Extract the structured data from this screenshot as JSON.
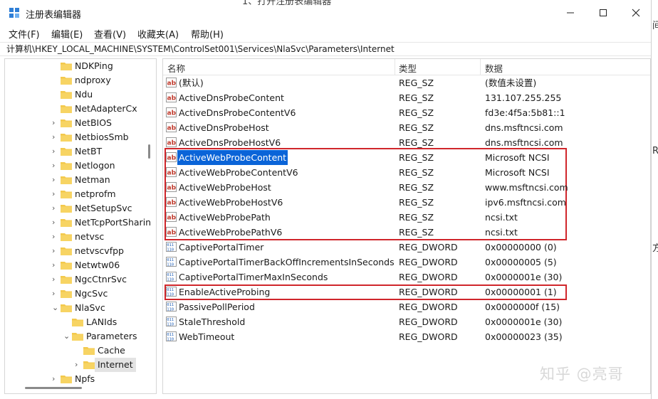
{
  "window": {
    "title": "注册表编辑器",
    "minimize": "—",
    "maximize": "☐",
    "close": "✕"
  },
  "background_header": "1、打开注册表编辑器",
  "menu": [
    "文件(F)",
    "编辑(E)",
    "查看(V)",
    "收藏夹(A)",
    "帮助(H)"
  ],
  "address": "计算机\\HKEY_LOCAL_MACHINE\\SYSTEM\\ControlSet001\\Services\\NlaSvc\\Parameters\\Internet",
  "tree": [
    {
      "label": "NDKPing",
      "level": 0,
      "chevron": ""
    },
    {
      "label": "ndproxy",
      "level": 0,
      "chevron": ""
    },
    {
      "label": "Ndu",
      "level": 0,
      "chevron": ""
    },
    {
      "label": "NetAdapterCx",
      "level": 0,
      "chevron": ""
    },
    {
      "label": "NetBIOS",
      "level": 0,
      "chevron": "›"
    },
    {
      "label": "NetbiosSmb",
      "level": 0,
      "chevron": "›"
    },
    {
      "label": "NetBT",
      "level": 0,
      "chevron": "›"
    },
    {
      "label": "Netlogon",
      "level": 0,
      "chevron": "›"
    },
    {
      "label": "Netman",
      "level": 0,
      "chevron": "›"
    },
    {
      "label": "netprofm",
      "level": 0,
      "chevron": "›"
    },
    {
      "label": "NetSetupSvc",
      "level": 0,
      "chevron": "›"
    },
    {
      "label": "NetTcpPortSharin",
      "level": 0,
      "chevron": "›"
    },
    {
      "label": "netvsc",
      "level": 0,
      "chevron": "›"
    },
    {
      "label": "netvscvfpp",
      "level": 0,
      "chevron": "›"
    },
    {
      "label": "Netwtw06",
      "level": 0,
      "chevron": "›"
    },
    {
      "label": "NgcCtnrSvc",
      "level": 0,
      "chevron": "›"
    },
    {
      "label": "NgcSvc",
      "level": 0,
      "chevron": "›"
    },
    {
      "label": "NlaSvc",
      "level": 0,
      "chevron": "⌄"
    },
    {
      "label": "LANIds",
      "level": 1,
      "chevron": ""
    },
    {
      "label": "Parameters",
      "level": 1,
      "chevron": "⌄"
    },
    {
      "label": "Cache",
      "level": 2,
      "chevron": ""
    },
    {
      "label": "Internet",
      "level": 2,
      "chevron": "›",
      "selected": true
    },
    {
      "label": "Npfs",
      "level": 0,
      "chevron": "›"
    }
  ],
  "columns": {
    "name": "名称",
    "type": "类型",
    "data": "数据"
  },
  "rows": [
    {
      "name": "(默认)",
      "type": "REG_SZ",
      "data": "(数值未设置)",
      "icon": "string"
    },
    {
      "name": "ActiveDnsProbeContent",
      "type": "REG_SZ",
      "data": "131.107.255.255",
      "icon": "string"
    },
    {
      "name": "ActiveDnsProbeContentV6",
      "type": "REG_SZ",
      "data": "fd3e:4f5a:5b81::1",
      "icon": "string"
    },
    {
      "name": "ActiveDnsProbeHost",
      "type": "REG_SZ",
      "data": "dns.msftncsi.com",
      "icon": "string"
    },
    {
      "name": "ActiveDnsProbeHostV6",
      "type": "REG_SZ",
      "data": "dns.msftncsi.com",
      "icon": "string"
    },
    {
      "name": "ActiveWebProbeContent",
      "type": "REG_SZ",
      "data": "Microsoft NCSI",
      "icon": "string",
      "selected": true
    },
    {
      "name": "ActiveWebProbeContentV6",
      "type": "REG_SZ",
      "data": "Microsoft NCSI",
      "icon": "string"
    },
    {
      "name": "ActiveWebProbeHost",
      "type": "REG_SZ",
      "data": "www.msftncsi.com",
      "icon": "string"
    },
    {
      "name": "ActiveWebProbeHostV6",
      "type": "REG_SZ",
      "data": "ipv6.msftncsi.com",
      "icon": "string"
    },
    {
      "name": "ActiveWebProbePath",
      "type": "REG_SZ",
      "data": "ncsi.txt",
      "icon": "string"
    },
    {
      "name": "ActiveWebProbePathV6",
      "type": "REG_SZ",
      "data": "ncsi.txt",
      "icon": "string"
    },
    {
      "name": "CaptivePortalTimer",
      "type": "REG_DWORD",
      "data": "0x00000000 (0)",
      "icon": "dword"
    },
    {
      "name": "CaptivePortalTimerBackOffIncrementsInSeconds",
      "type": "REG_DWORD",
      "data": "0x00000005 (5)",
      "icon": "dword"
    },
    {
      "name": "CaptivePortalTimerMaxInSeconds",
      "type": "REG_DWORD",
      "data": "0x0000001e (30)",
      "icon": "dword"
    },
    {
      "name": "EnableActiveProbing",
      "type": "REG_DWORD",
      "data": "0x00000001 (1)",
      "icon": "dword"
    },
    {
      "name": "PassivePollPeriod",
      "type": "REG_DWORD",
      "data": "0x0000000f (15)",
      "icon": "dword"
    },
    {
      "name": "StaleThreshold",
      "type": "REG_DWORD",
      "data": "0x0000001e (30)",
      "icon": "dword"
    },
    {
      "name": "WebTimeout",
      "type": "REG_DWORD",
      "data": "0x00000023 (35)",
      "icon": "dword"
    }
  ],
  "edge_glyphs": [
    "间",
    "R",
    "方"
  ],
  "watermark": "知乎 @亮哥",
  "colors": {
    "selection": "#0a64d8",
    "highlight_box": "#d0262b",
    "folder": "#f3c94c"
  }
}
